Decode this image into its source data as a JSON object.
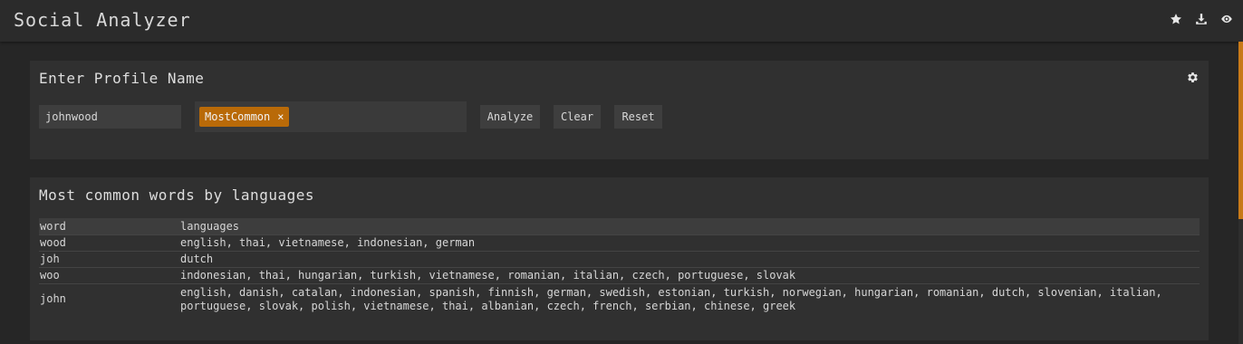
{
  "app": {
    "title": "Social Analyzer",
    "icons": [
      "star-icon",
      "download-icon",
      "eye-icon"
    ]
  },
  "colors": {
    "accent": "#b96a08",
    "background": "#262626",
    "panel": "#303030"
  },
  "profile_panel": {
    "title": "Enter Profile Name",
    "name_value": "johnwood",
    "tag_label": "MostCommon",
    "tag_remove": "×",
    "buttons": {
      "analyze": "Analyze",
      "clear": "Clear",
      "reset": "Reset"
    }
  },
  "results_panel": {
    "title": "Most common words by languages",
    "columns": [
      "word",
      "languages"
    ],
    "rows": [
      {
        "word": "wood",
        "languages": "english, thai, vietnamese, indonesian, german"
      },
      {
        "word": "joh",
        "languages": "dutch"
      },
      {
        "word": "woo",
        "languages": "indonesian, thai, hungarian, turkish, vietnamese, romanian, italian, czech, portuguese, slovak"
      },
      {
        "word": "john",
        "languages": "english, danish, catalan, indonesian, spanish, finnish, german, swedish, estonian, turkish, norwegian, hungarian, romanian, dutch, slovenian, italian, portuguese, slovak, polish, vietnamese, thai, albanian, czech, french, serbian, chinese, greek"
      }
    ]
  }
}
